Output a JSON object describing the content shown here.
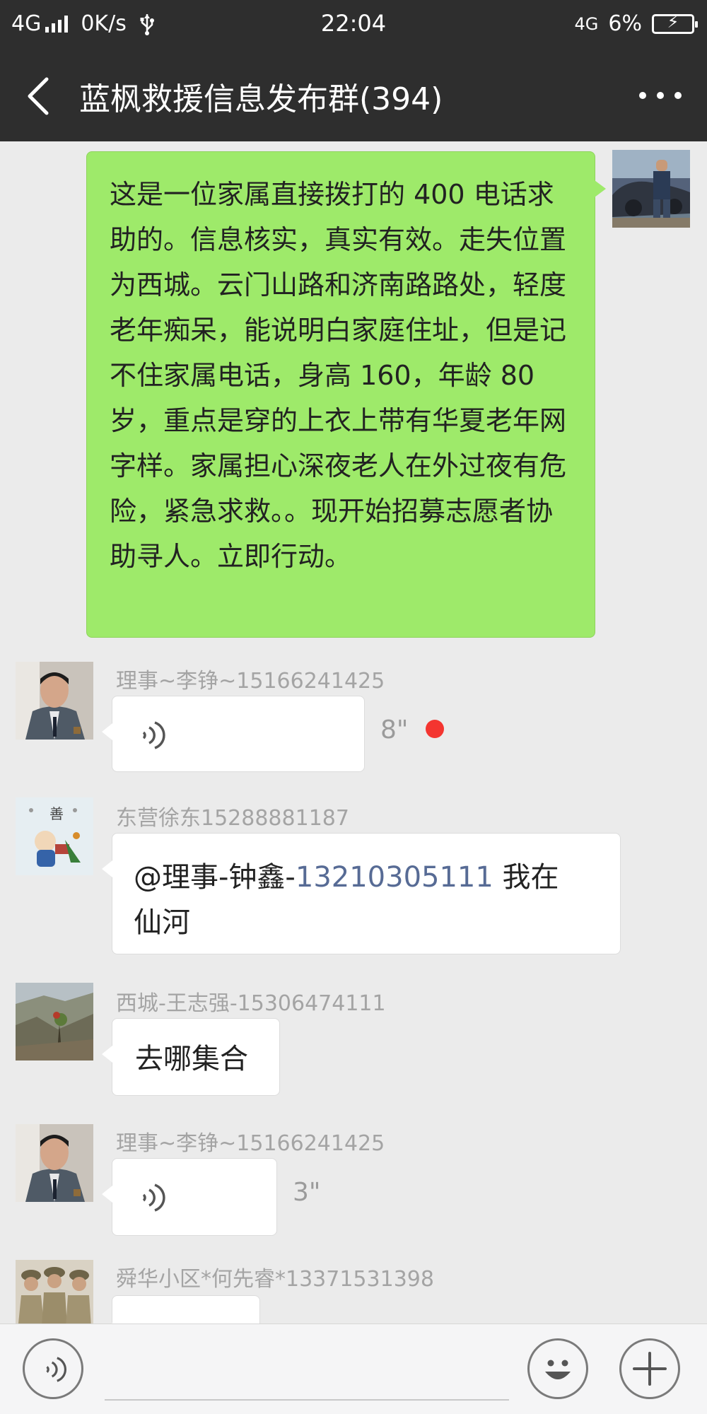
{
  "status_bar": {
    "network": "4G",
    "speed": "0K/s",
    "time": "22:04",
    "network_right": "4G",
    "battery": "6%"
  },
  "header": {
    "title": "蓝枫救援信息发布群(394)"
  },
  "messages": [
    {
      "type": "text",
      "side": "right",
      "text": "这是一位家属直接拨打的 400 电话求助的。信息核实，真实有效。走失位置为西城。云门山路和济南路路处，轻度老年痴呆，能说明白家庭住址，但是记不住家属电话，身高 160，年龄 80 岁，重点是穿的上衣上带有华夏老年网字样。家属担心深夜老人在外过夜有危险，紧急求救。。现开始招募志愿者协助寻人。立即行动。"
    },
    {
      "type": "voice",
      "side": "left",
      "sender": "理事~李铮~15166241425",
      "duration": "8\"",
      "unread": true
    },
    {
      "type": "text",
      "side": "left",
      "sender": "东营徐东15288881187",
      "mention": "@理事-钟鑫-",
      "phone": "13210305111",
      "text_after": " 我在",
      "text_line2": "仙河"
    },
    {
      "type": "text",
      "side": "left",
      "sender": "西城-王志强-15306474111",
      "text": "去哪集合"
    },
    {
      "type": "voice",
      "side": "left",
      "sender": "理事~李铮~15166241425",
      "duration": "3\"",
      "unread": false
    },
    {
      "type": "partial",
      "side": "left",
      "sender": "舜华小区*何先睿*13371531398"
    }
  ],
  "colors": {
    "header_bg": "#2e2e2e",
    "chat_bg": "#ebebeb",
    "own_bubble": "#9eea6a",
    "unread_dot": "#f43530",
    "link": "#576b95"
  },
  "icons": {
    "back": "chevron-left-icon",
    "more": "more-dots-icon",
    "voice": "voice-wave-icon",
    "emoji": "emoji-smile-icon",
    "add": "plus-icon"
  }
}
